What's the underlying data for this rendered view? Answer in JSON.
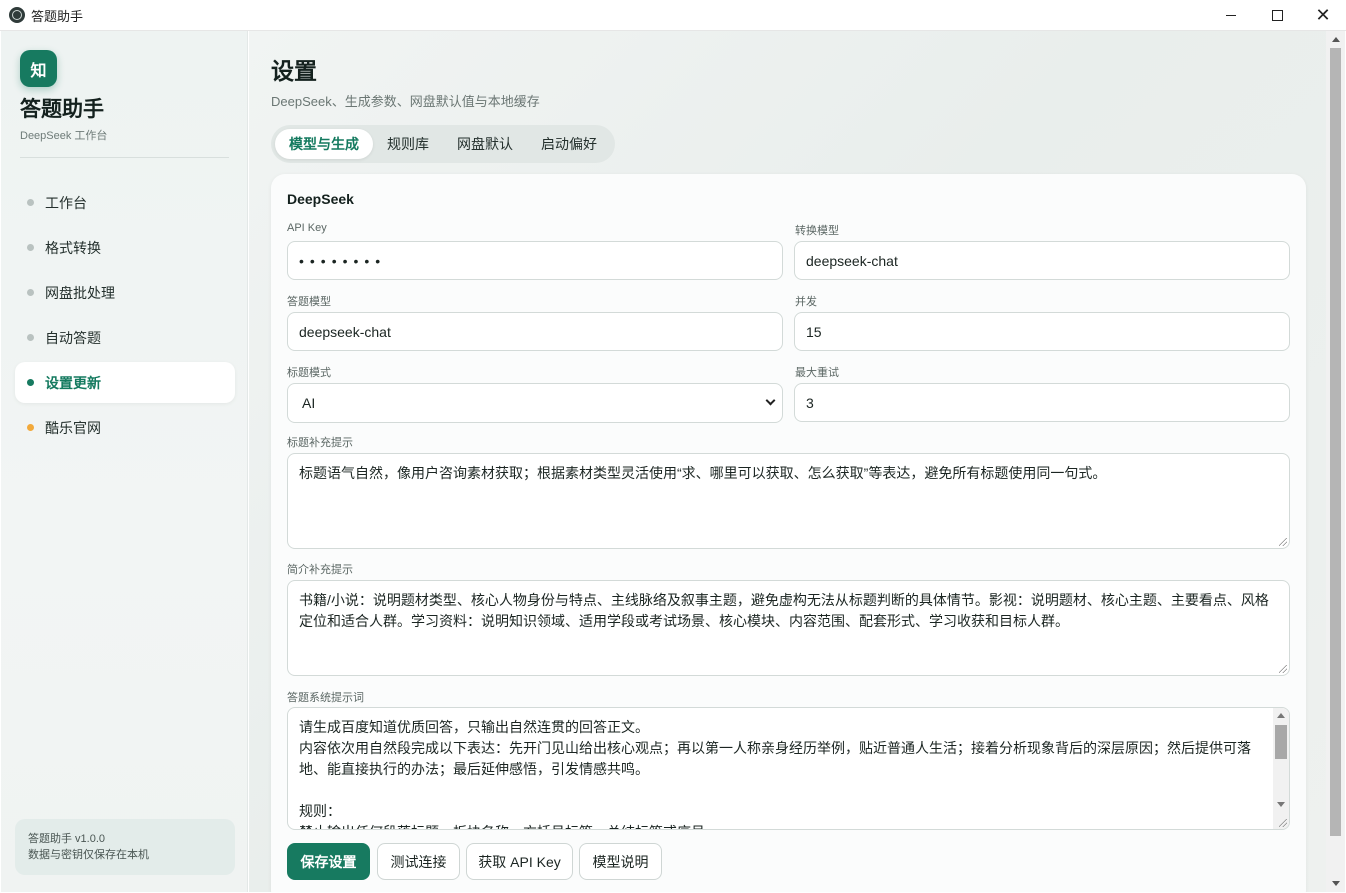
{
  "window": {
    "title": "答题助手",
    "controls": {
      "minimize": "",
      "maximize": "",
      "close": "✕"
    }
  },
  "sidebar": {
    "logo_char": "知",
    "app_name": "答题助手",
    "app_sub": "DeepSeek 工作台",
    "items": [
      {
        "label": "工作台",
        "active": false
      },
      {
        "label": "格式转换",
        "active": false
      },
      {
        "label": "网盘批处理",
        "active": false
      },
      {
        "label": "自动答题",
        "active": false
      },
      {
        "label": "设置更新",
        "active": true
      },
      {
        "label": "酷乐官网",
        "active": false
      }
    ],
    "version": "答题助手 v1.0.0",
    "storage_note": "数据与密钥仅保存在本机"
  },
  "page": {
    "title": "设置",
    "subtitle": "DeepSeek、生成参数、网盘默认值与本地缓存",
    "tabs": [
      "模型与生成",
      "规则库",
      "网盘默认",
      "启动偏好"
    ]
  },
  "form": {
    "section_title": "DeepSeek",
    "api_key": {
      "label": "API Key",
      "value": "••••••••"
    },
    "convert_model": {
      "label": "转换模型",
      "value": "deepseek-chat"
    },
    "answer_model": {
      "label": "答题模型",
      "value": "deepseek-chat"
    },
    "concurrency": {
      "label": "并发",
      "value": "15"
    },
    "title_mode": {
      "label": "标题模式",
      "value": "AI"
    },
    "max_retry": {
      "label": "最大重试",
      "value": "3"
    },
    "title_hint": {
      "label": "标题补充提示",
      "value": "标题语气自然，像用户咨询素材获取；根据素材类型灵活使用“求、哪里可以获取、怎么获取”等表达，避免所有标题使用同一句式。"
    },
    "intro_hint": {
      "label": "简介补充提示",
      "value": "书籍/小说：说明题材类型、核心人物身份与特点、主线脉络及叙事主题，避免虚构无法从标题判断的具体情节。影视：说明题材、核心主题、主要看点、风格定位和适合人群。学习资料：说明知识领域、适用学段或考试场景、核心模块、内容范围、配套形式、学习收获和目标人群。"
    },
    "system_prompt": {
      "label": "答题系统提示词",
      "lines": [
        "请生成百度知道优质回答，只输出自然连贯的回答正文。",
        "内容依次用自然段完成以下表达：先开门见山给出核心观点；再以第一人称亲身经历举例，贴近普通人生活；接着分析现象背后的深层原因；然后提供可落地、能直接执行的办法；最后延伸感悟，引发情感共鸣。",
        "",
        "规则：",
        "禁止输出任何段落标题、板块名称、方括号标签、总结标签或序号。"
      ]
    }
  },
  "buttons": {
    "save": "保存设置",
    "test": "测试连接",
    "get_key": "获取 API Key",
    "model_help": "模型说明"
  }
}
